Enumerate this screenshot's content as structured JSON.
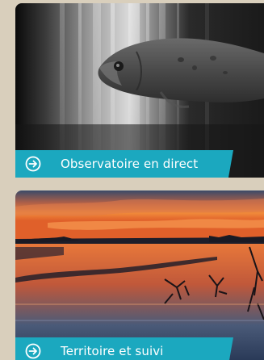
{
  "cards": [
    {
      "caption": "Observatoire en direct",
      "icon": "circle-arrow-right-icon",
      "image": "fish-underwater-camera-photo"
    },
    {
      "caption": "Territoire et suivi",
      "icon": "circle-arrow-right-icon",
      "image": "wetland-sunset-photo"
    }
  ],
  "colors": {
    "background": "#d9cfbc",
    "caption_bar": "#1ba8bf",
    "caption_text": "#ffffff"
  }
}
